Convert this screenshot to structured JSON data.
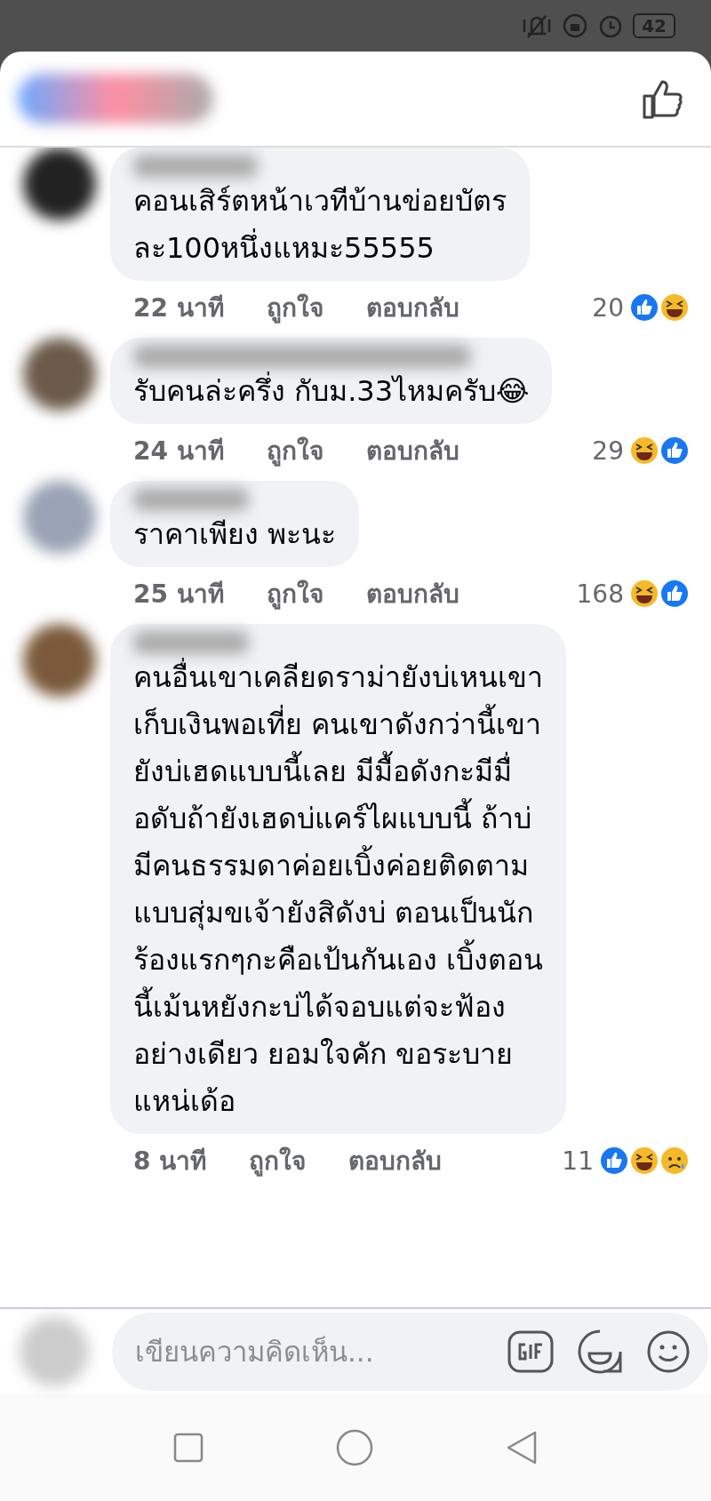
{
  "status_bar": {
    "battery": "42"
  },
  "comments": [
    {
      "text": "คอนเสิร์ตหน้าเวทีบ้านข่อยบัตร\nละ100หนึ่งแหมะ55555",
      "time": "22 นาที",
      "like": "ถูกใจ",
      "reply": "ตอบกลับ",
      "count": "20",
      "reactions": [
        {
          "kind": "like"
        },
        {
          "kind": "haha"
        }
      ]
    },
    {
      "text": "รับคนล่ะครึ่ง กับม.33ไหมครับ😂",
      "time": "24 นาที",
      "like": "ถูกใจ",
      "reply": "ตอบกลับ",
      "count": "29",
      "reactions": [
        {
          "kind": "haha"
        },
        {
          "kind": "like"
        }
      ]
    },
    {
      "text": "ราคาเพียง พะนะ",
      "time": "25 นาที",
      "like": "ถูกใจ",
      "reply": "ตอบกลับ",
      "count": "168",
      "reactions": [
        {
          "kind": "haha"
        },
        {
          "kind": "like"
        }
      ]
    },
    {
      "text": "คนอื่นเขาเคลียดราม่ายังบ่เหนเขา\nเก็บเงินพอเที่ย  คนเขาดังกว่านี้เขา\nยังบ่เฮดแบบนี้เลย มีมื้อดังกะมีมื่\nอดับถ้ายังเฮดบ่แคร์ไผแบบนี้  ถ้าบ่\nมีคนธรรมดาค่อยเบิ้งค่อยติดตาม\nแบบสุ่มขเจ้ายังสิดังบ่  ตอนเป็นนัก\nร้องแรกๆกะคือเป้นกันเอง  เบิ้งตอน\nนี้เม้นหยังกะบ่ได้จอบแต่จะฟ้อง\nอย่างเดียว  ยอมใจคัก ขอระบาย\nแหน่เด้อ",
      "time": "8 นาที",
      "like": "ถูกใจ",
      "reply": "ตอบกลับ",
      "count": "11",
      "reactions": [
        {
          "kind": "like"
        },
        {
          "kind": "haha"
        },
        {
          "kind": "sad"
        }
      ]
    }
  ],
  "composer": {
    "placeholder": "เขียนความคิดเห็น..."
  }
}
